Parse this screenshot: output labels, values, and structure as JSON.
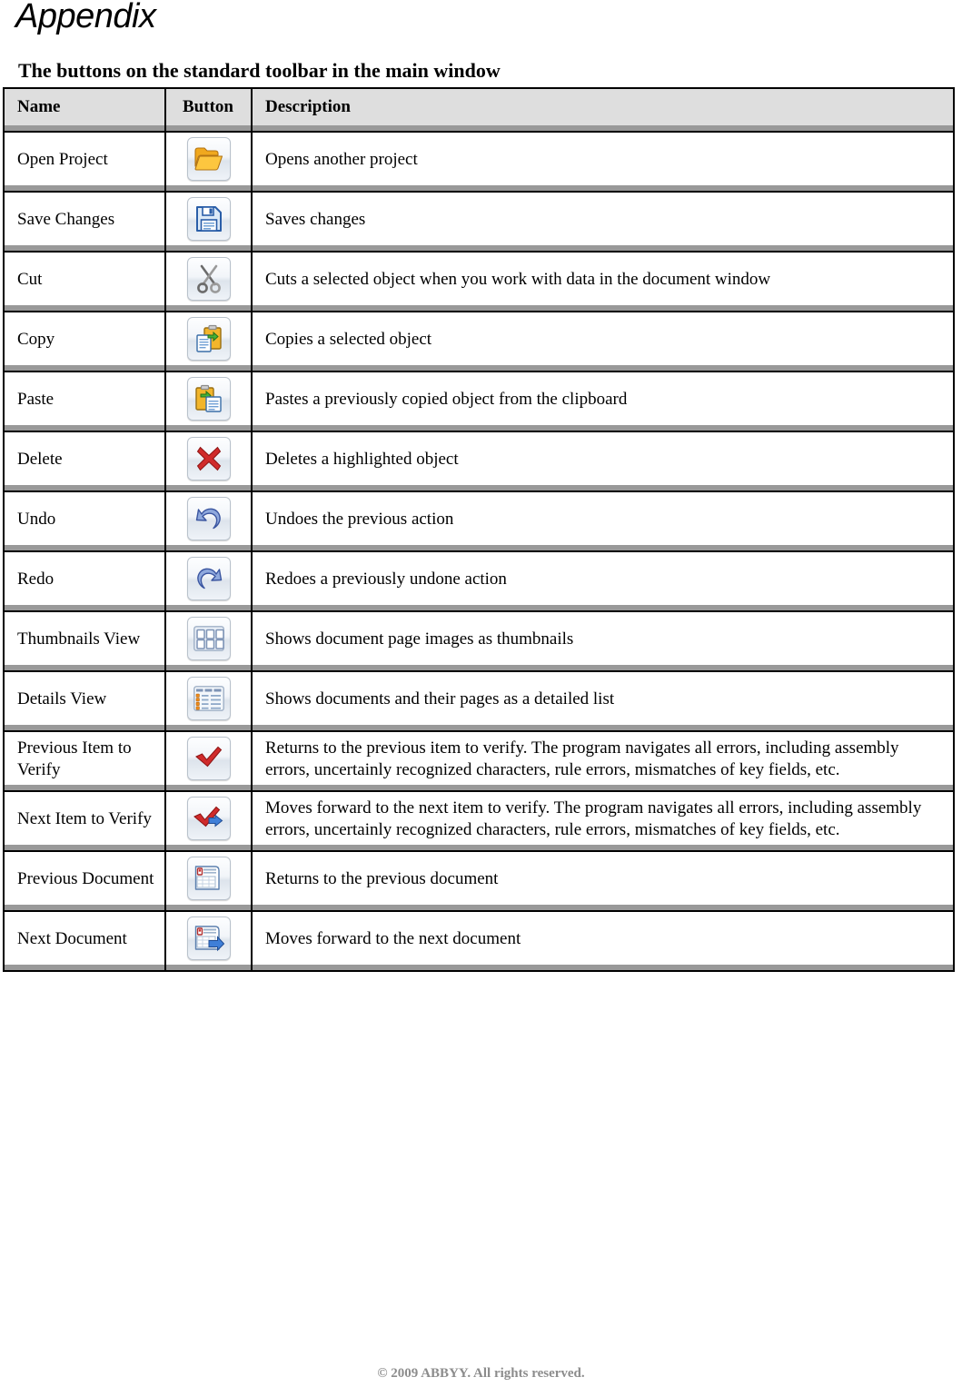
{
  "document": {
    "title": "Appendix",
    "section_heading": "The buttons on the standard toolbar in the main window",
    "footer": "© 2009 ABBYY. All rights reserved."
  },
  "table": {
    "headers": {
      "name": "Name",
      "button": "Button",
      "description": "Description"
    },
    "rows": [
      {
        "name": "Open Project",
        "icon": "open-folder-icon",
        "description": "Opens another project"
      },
      {
        "name": "Save Changes",
        "icon": "floppy-disk-save-icon",
        "description": "Saves changes"
      },
      {
        "name": "Cut",
        "icon": "scissors-cut-icon",
        "description": "Cuts a selected object when you work with data in the document window"
      },
      {
        "name": "Copy",
        "icon": "copy-clipboard-icon",
        "description": "Copies a selected object"
      },
      {
        "name": "Paste",
        "icon": "paste-clipboard-icon",
        "description": "Pastes a previously copied object from the clipboard"
      },
      {
        "name": "Delete",
        "icon": "red-x-delete-icon",
        "description": "Deletes a highlighted object"
      },
      {
        "name": "Undo",
        "icon": "undo-arrow-icon",
        "description": "Undoes the previous action"
      },
      {
        "name": "Redo",
        "icon": "redo-arrow-icon",
        "description": "Redoes a previously undone action"
      },
      {
        "name": "Thumbnails View",
        "icon": "thumbnails-grid-icon",
        "description": "Shows document page images as thumbnails"
      },
      {
        "name": "Details View",
        "icon": "details-list-icon",
        "description": "Shows documents and their pages as a detailed list"
      },
      {
        "name": "Previous Item to Verify",
        "icon": "check-left-arrow-icon",
        "description": "Returns to the previous item to verify. The program navigates all errors, including assembly errors, uncertainly recognized characters, rule errors, mismatches of key fields, etc."
      },
      {
        "name": "Next Item to Verify",
        "icon": "check-right-arrow-icon",
        "description": "Moves forward to the next item to verify. The program navigates all errors, including assembly errors, uncertainly recognized characters, rule errors, mismatches of key fields, etc."
      },
      {
        "name": "Previous Document",
        "icon": "document-left-arrow-icon",
        "description": "Returns to the previous document"
      },
      {
        "name": "Next Document",
        "icon": "document-right-arrow-icon",
        "description": "Moves forward to the next document"
      }
    ]
  },
  "colors": {
    "header_bg": "#dedede",
    "separator_gray": "#999999",
    "border_black": "#000000",
    "footer_text": "#8c8c8c",
    "icon_orange": "#f5a623",
    "icon_blue": "#3366cc",
    "icon_red": "#cc2222",
    "icon_green": "#3fa72f"
  }
}
